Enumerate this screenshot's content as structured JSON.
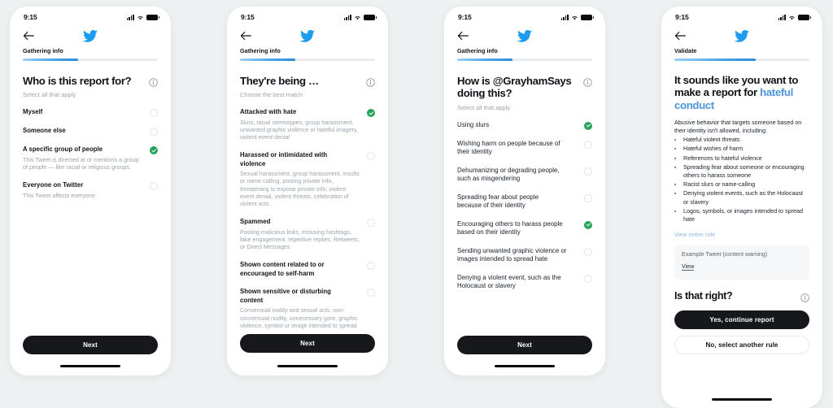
{
  "colors": {
    "background": "#eef1f2",
    "twitter_blue": "#1d9bf0",
    "accent_link": "#4d95d9",
    "selected_green": "#25a55a",
    "button_dark": "#16181c",
    "text_primary": "#0f1419",
    "text_muted": "#9aa3aa"
  },
  "status_bar": {
    "time": "9:15",
    "icons": [
      "signal-bars-icon",
      "wifi-icon",
      "battery-icon"
    ]
  },
  "panels": [
    {
      "id": "panel-who-is-report-for",
      "nav": {
        "back": "back-arrow-icon",
        "logo": "twitter-bird-icon"
      },
      "step_label": "Gathering info",
      "progress_percent": 41,
      "title": "Who is this report for?",
      "subtitle": "Select all that apply",
      "info_icon": "info-icon",
      "options": [
        {
          "label": "Myself",
          "desc": "",
          "selected": false
        },
        {
          "label": "Someone else",
          "desc": "",
          "selected": false
        },
        {
          "label": "A specific group of people",
          "desc": "This Tweet is directed at or mentions a group of people — like racial or religious groups.",
          "selected": true
        },
        {
          "label": "Everyone on Twitter",
          "desc": "This Tweet affects everyone.",
          "selected": false
        }
      ],
      "primary_button": "Next"
    },
    {
      "id": "panel-theyre-being",
      "nav": {
        "back": "back-arrow-icon",
        "logo": "twitter-bird-icon"
      },
      "step_label": "Gathering info",
      "progress_percent": 41,
      "title": "They're being …",
      "subtitle": "Choose the best match",
      "info_icon": "info-icon",
      "options": [
        {
          "label": "Attacked with hate",
          "desc": "Slurs, racial stereotypes, group harassment, unwanted graphic violence or hateful imagery, violent event denial",
          "selected": true
        },
        {
          "label": "Harassed or intimidated with violence",
          "desc": "Sexual harassment, group harassment, insults or name calling, posting private info, threatening to expose private info, violent event denial, violent threats, celebration of violent acts",
          "selected": false
        },
        {
          "label": "Spammed",
          "desc": "Posting malicious links, misusing hashtags, fake engagement, repetitive replies, Retweets, or Direct Messages",
          "selected": false
        },
        {
          "label": "Shown content related to or encouraged to self-harm",
          "desc": "",
          "selected": false
        },
        {
          "label": "Shown sensitive or disturbing content",
          "desc": "Consensual nudity and sexual acts, non-consensual nudity, unnecessary gore, graphic violence, symbol or image intended to spread hate based on someone's identity",
          "selected": false
        }
      ],
      "primary_button": "Next"
    },
    {
      "id": "panel-how-is-user-doing-this",
      "nav": {
        "back": "back-arrow-icon",
        "logo": "twitter-bird-icon"
      },
      "step_label": "Gathering info",
      "progress_percent": 41,
      "title": "How is @GrayhamSays doing this?",
      "subtitle": "Select all that apply",
      "info_icon": "info-icon",
      "options": [
        {
          "label": "Using slurs",
          "desc": "",
          "selected": true
        },
        {
          "label": "Wishing harm on people because of their identity",
          "desc": "",
          "selected": false
        },
        {
          "label": "Dehumanizing or degrading people, such as misgendering",
          "desc": "",
          "selected": false
        },
        {
          "label": "Spreading fear about people because of their identity",
          "desc": "",
          "selected": false
        },
        {
          "label": "Encouraging others to harass people based on their identity",
          "desc": "",
          "selected": true
        },
        {
          "label": "Sending unwanted graphic violence or images intended to spread hate",
          "desc": "",
          "selected": false
        },
        {
          "label": "Denying a violent event, such as the Holocaust or slavery",
          "desc": "",
          "selected": false
        }
      ],
      "primary_button": "Next"
    },
    {
      "id": "panel-validate",
      "nav": {
        "back": "back-arrow-icon",
        "logo": "twitter-bird-icon"
      },
      "step_label": "Validate",
      "progress_percent": 60,
      "title_lead": "It sounds like you want to make a report for ",
      "title_accent": "hateful conduct",
      "paragraph": "Abusive behavior that targets someone based on their identity isn't allowed, including:",
      "bullets": [
        "Hateful violent threats",
        "Hateful wishes of harm",
        "References to hateful violence",
        "Spreading fear about someone or encouraging others to harass someone",
        "Racist slurs or name-calling",
        "Denying violent events, such as the Holocaust or slavery",
        "Logos, symbols, or images intended to spread hate"
      ],
      "view_rule_link": "View entire rule",
      "example_box": {
        "title": "Example Tweet (content warning)",
        "view_link": "View"
      },
      "question": "Is that right?",
      "info_icon": "info-icon",
      "primary_button": "Yes, continue report",
      "secondary_button": "No, select another rule"
    }
  ]
}
